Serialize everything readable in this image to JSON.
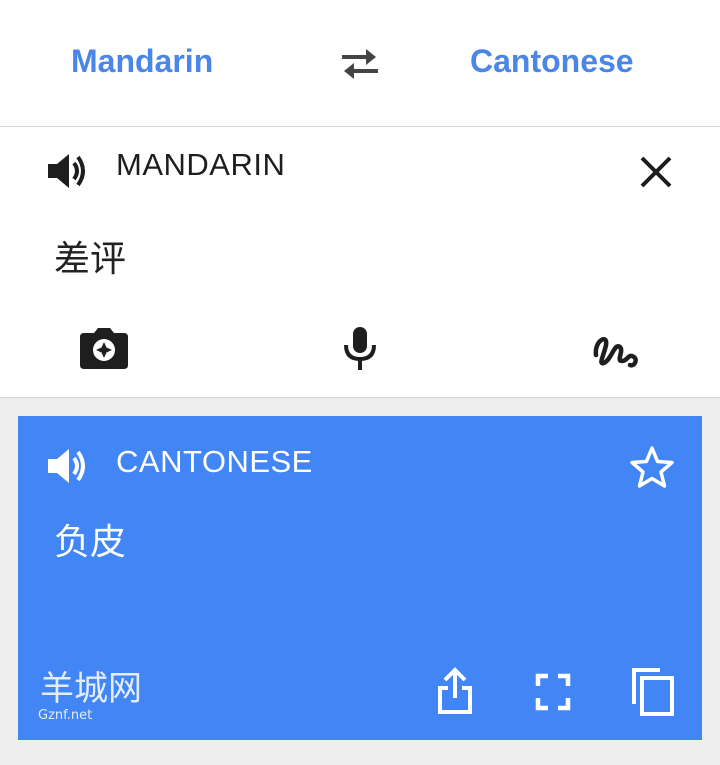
{
  "header": {
    "source_language": "Mandarin",
    "target_language": "Cantonese",
    "swap_icon": "swap-arrows-icon"
  },
  "input_card": {
    "language_label": "MANDARIN",
    "text": "差评",
    "icons": {
      "speaker": "speaker-icon",
      "close": "close-icon",
      "camera": "camera-icon",
      "microphone": "microphone-icon",
      "handwriting": "handwriting-icon"
    }
  },
  "output_card": {
    "language_label": "CANTONESE",
    "text": "负皮",
    "icons": {
      "speaker": "speaker-icon",
      "star": "star-icon",
      "share": "share-icon",
      "fullscreen": "fullscreen-icon",
      "copy": "copy-icon"
    }
  },
  "watermark": {
    "logo_text": "羊城网",
    "site_text": "Gznf.net"
  },
  "colors": {
    "accent": "#4a86e8",
    "output_background": "#4285f4",
    "page_background": "#ededed",
    "card_background": "#ffffff",
    "icon_dark": "#1e1e1e"
  }
}
